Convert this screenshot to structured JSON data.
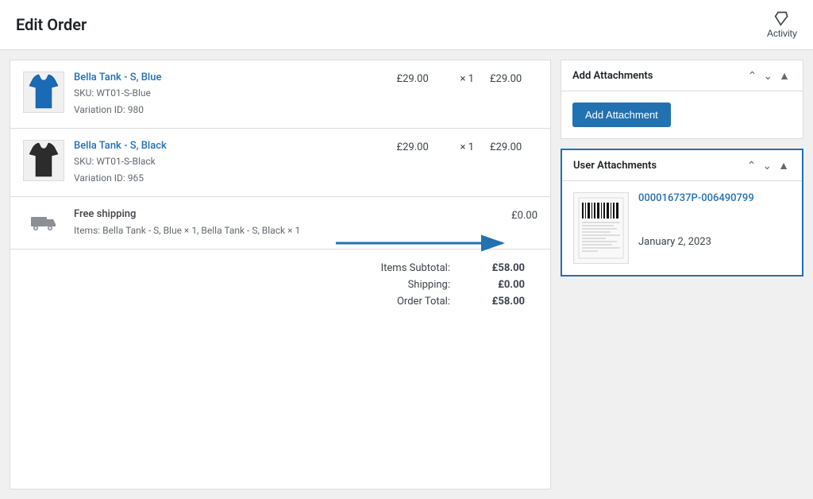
{
  "header": {
    "title": "Edit Order",
    "activity_label": "Activity"
  },
  "order_items": [
    {
      "id": "item-1",
      "name": "Bella Tank - S, Blue",
      "sku_label": "SKU:",
      "sku": "WT01-S-Blue",
      "variation_label": "Variation ID:",
      "variation_id": "980",
      "price": "£29.00",
      "qty": "× 1",
      "total": "£29.00",
      "image_color": "blue"
    },
    {
      "id": "item-2",
      "name": "Bella Tank - S, Black",
      "sku_label": "SKU:",
      "sku": "WT01-S-Black",
      "variation_label": "Variation ID:",
      "variation_id": "965",
      "price": "£29.00",
      "qty": "× 1",
      "total": "£29.00",
      "image_color": "black"
    }
  ],
  "shipping": {
    "label": "Free shipping",
    "items_label": "Items:",
    "items_text": "Bella Tank - S, Blue × 1, Bella Tank - S, Black × 1",
    "price": "£0.00"
  },
  "totals": {
    "subtotal_label": "Items Subtotal:",
    "subtotal_value": "£58.00",
    "shipping_label": "Shipping:",
    "shipping_value": "£0.00",
    "order_total_label": "Order Total:",
    "order_total_value": "£58.00"
  },
  "add_attachments_panel": {
    "title": "Add Attachments",
    "add_button_label": "Add Attachment"
  },
  "user_attachments_panel": {
    "title": "User Attachments",
    "attachment": {
      "name": "000016737P-006490799",
      "date": "January 2, 2023"
    }
  }
}
